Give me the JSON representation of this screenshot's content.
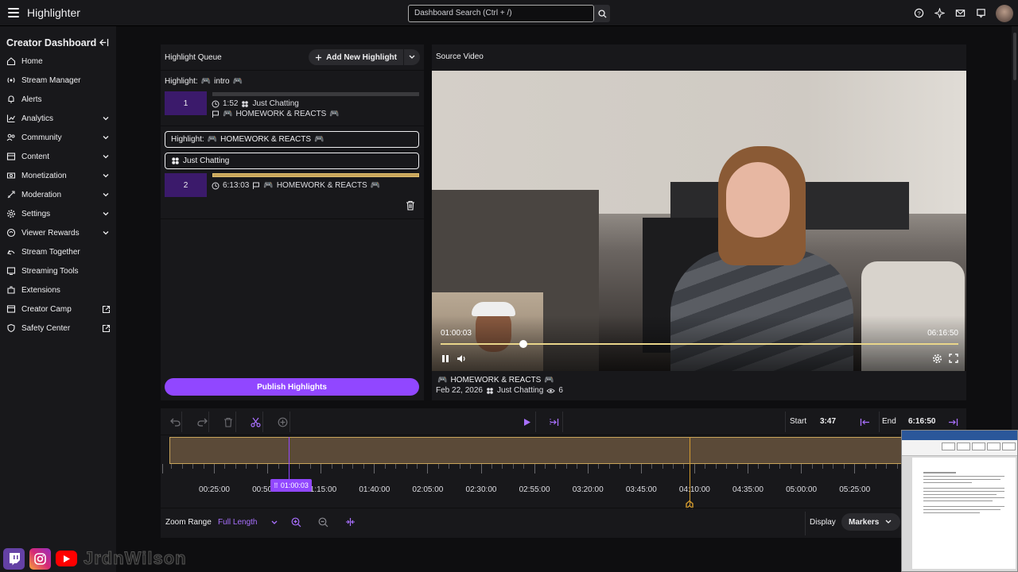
{
  "topbar": {
    "app_title": "Highlighter",
    "search_placeholder": "Dashboard Search (Ctrl + /)"
  },
  "sidebar": {
    "title": "Creator Dashboard",
    "items": [
      {
        "label": "Home",
        "icon": "home-icon",
        "expandable": false,
        "external": false
      },
      {
        "label": "Stream Manager",
        "icon": "broadcast-icon",
        "expandable": false,
        "external": false
      },
      {
        "label": "Alerts",
        "icon": "bell-icon",
        "expandable": false,
        "external": false
      },
      {
        "label": "Analytics",
        "icon": "chart-icon",
        "expandable": true,
        "external": false
      },
      {
        "label": "Community",
        "icon": "community-icon",
        "expandable": true,
        "external": false
      },
      {
        "label": "Content",
        "icon": "content-icon",
        "expandable": true,
        "external": false
      },
      {
        "label": "Monetization",
        "icon": "money-icon",
        "expandable": true,
        "external": false
      },
      {
        "label": "Moderation",
        "icon": "sword-icon",
        "expandable": true,
        "external": false
      },
      {
        "label": "Settings",
        "icon": "gear-icon",
        "expandable": true,
        "external": false
      },
      {
        "label": "Viewer Rewards",
        "icon": "rewards-icon",
        "expandable": true,
        "external": false
      },
      {
        "label": "Stream Together",
        "icon": "stream-together-icon",
        "expandable": false,
        "external": false
      },
      {
        "label": "Streaming Tools",
        "icon": "tools-icon",
        "expandable": false,
        "external": false
      },
      {
        "label": "Extensions",
        "icon": "extensions-icon",
        "expandable": false,
        "external": false
      },
      {
        "label": "Creator Camp",
        "icon": "camp-icon",
        "expandable": false,
        "external": true
      },
      {
        "label": "Safety Center",
        "icon": "shield-icon",
        "expandable": false,
        "external": true
      }
    ]
  },
  "queue": {
    "title": "Highlight Queue",
    "add_button": "Add New Highlight",
    "highlight1": {
      "label": "Highlight:",
      "name": "intro",
      "number": "1",
      "duration": "1:52",
      "category": "Just Chatting",
      "source": "HOMEWORK & REACTS"
    },
    "highlight2": {
      "title_label": "Highlight:",
      "title_value": "HOMEWORK & REACTS",
      "category": "Just Chatting",
      "number": "2",
      "duration": "6:13:03",
      "source": "HOMEWORK & REACTS"
    },
    "publish_button": "Publish Highlights"
  },
  "source": {
    "title": "Source Video",
    "current_time": "01:00:03",
    "end_time": "06:16:50",
    "seek_progress": 0.16,
    "video_title": "HOMEWORK & REACTS",
    "date": "Feb 22, 2026",
    "category": "Just Chatting",
    "views": "6"
  },
  "timeline": {
    "start_label": "Start",
    "start_value": "3:47",
    "end_label": "End",
    "end_value": "6:16:50",
    "playhead_label": "01:00:03",
    "tick_labels": [
      "00:25:00",
      "00:50:00",
      "01:15:00",
      "01:40:00",
      "02:05:00",
      "02:30:00",
      "02:55:00",
      "03:20:00",
      "03:45:00",
      "04:10:00",
      "04:35:00",
      "05:00:00",
      "05:25:00",
      "05"
    ],
    "zoom_range_label": "Zoom Range",
    "zoom_range_value": "Full Length",
    "display_label": "Display",
    "display_value": "Markers"
  },
  "colors": {
    "accent": "#9147ff",
    "track": "#5b4a38",
    "end_marker": "#d39b2f",
    "number_box": "#3b1a6b"
  },
  "overlay": {
    "handle": "JrdnWilson"
  }
}
